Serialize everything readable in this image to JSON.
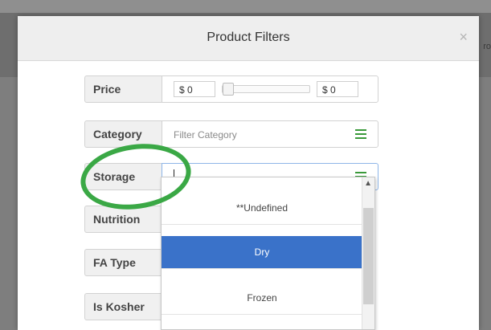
{
  "background": {
    "ghost_text": "ro"
  },
  "modal": {
    "title": "Product Filters",
    "close_label": "×"
  },
  "filters": {
    "price": {
      "label": "Price",
      "min": "$ 0",
      "max": "$ 0"
    },
    "category": {
      "label": "Category",
      "placeholder": "Filter Category",
      "icon": "list-icon"
    },
    "storage": {
      "label": "Storage",
      "value": "",
      "icon": "list-icon"
    },
    "nutrition": {
      "label": "Nutrition"
    },
    "fa_type": {
      "label": "FA Type"
    },
    "is_kosher": {
      "label": "Is Kosher"
    }
  },
  "storage_dropdown": {
    "options": [
      "**Undefined",
      "Dry",
      "Frozen"
    ],
    "selected": "Dry"
  },
  "colors": {
    "accent": "#3a72c9",
    "menu_icon": "#3a9a3a",
    "annotation_circle": "#3aa845"
  }
}
